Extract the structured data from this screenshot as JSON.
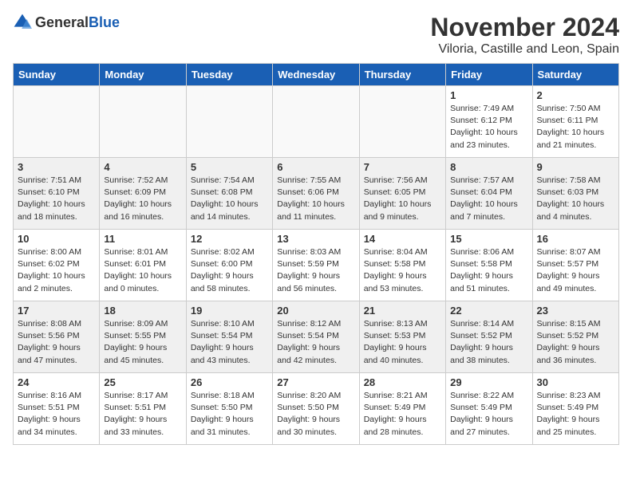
{
  "header": {
    "logo_general": "General",
    "logo_blue": "Blue",
    "month_title": "November 2024",
    "location": "Viloria, Castille and Leon, Spain"
  },
  "weekdays": [
    "Sunday",
    "Monday",
    "Tuesday",
    "Wednesday",
    "Thursday",
    "Friday",
    "Saturday"
  ],
  "weeks": [
    [
      {
        "day": "",
        "info": ""
      },
      {
        "day": "",
        "info": ""
      },
      {
        "day": "",
        "info": ""
      },
      {
        "day": "",
        "info": ""
      },
      {
        "day": "",
        "info": ""
      },
      {
        "day": "1",
        "info": "Sunrise: 7:49 AM\nSunset: 6:12 PM\nDaylight: 10 hours\nand 23 minutes."
      },
      {
        "day": "2",
        "info": "Sunrise: 7:50 AM\nSunset: 6:11 PM\nDaylight: 10 hours\nand 21 minutes."
      }
    ],
    [
      {
        "day": "3",
        "info": "Sunrise: 7:51 AM\nSunset: 6:10 PM\nDaylight: 10 hours\nand 18 minutes."
      },
      {
        "day": "4",
        "info": "Sunrise: 7:52 AM\nSunset: 6:09 PM\nDaylight: 10 hours\nand 16 minutes."
      },
      {
        "day": "5",
        "info": "Sunrise: 7:54 AM\nSunset: 6:08 PM\nDaylight: 10 hours\nand 14 minutes."
      },
      {
        "day": "6",
        "info": "Sunrise: 7:55 AM\nSunset: 6:06 PM\nDaylight: 10 hours\nand 11 minutes."
      },
      {
        "day": "7",
        "info": "Sunrise: 7:56 AM\nSunset: 6:05 PM\nDaylight: 10 hours\nand 9 minutes."
      },
      {
        "day": "8",
        "info": "Sunrise: 7:57 AM\nSunset: 6:04 PM\nDaylight: 10 hours\nand 7 minutes."
      },
      {
        "day": "9",
        "info": "Sunrise: 7:58 AM\nSunset: 6:03 PM\nDaylight: 10 hours\nand 4 minutes."
      }
    ],
    [
      {
        "day": "10",
        "info": "Sunrise: 8:00 AM\nSunset: 6:02 PM\nDaylight: 10 hours\nand 2 minutes."
      },
      {
        "day": "11",
        "info": "Sunrise: 8:01 AM\nSunset: 6:01 PM\nDaylight: 10 hours\nand 0 minutes."
      },
      {
        "day": "12",
        "info": "Sunrise: 8:02 AM\nSunset: 6:00 PM\nDaylight: 9 hours\nand 58 minutes."
      },
      {
        "day": "13",
        "info": "Sunrise: 8:03 AM\nSunset: 5:59 PM\nDaylight: 9 hours\nand 56 minutes."
      },
      {
        "day": "14",
        "info": "Sunrise: 8:04 AM\nSunset: 5:58 PM\nDaylight: 9 hours\nand 53 minutes."
      },
      {
        "day": "15",
        "info": "Sunrise: 8:06 AM\nSunset: 5:58 PM\nDaylight: 9 hours\nand 51 minutes."
      },
      {
        "day": "16",
        "info": "Sunrise: 8:07 AM\nSunset: 5:57 PM\nDaylight: 9 hours\nand 49 minutes."
      }
    ],
    [
      {
        "day": "17",
        "info": "Sunrise: 8:08 AM\nSunset: 5:56 PM\nDaylight: 9 hours\nand 47 minutes."
      },
      {
        "day": "18",
        "info": "Sunrise: 8:09 AM\nSunset: 5:55 PM\nDaylight: 9 hours\nand 45 minutes."
      },
      {
        "day": "19",
        "info": "Sunrise: 8:10 AM\nSunset: 5:54 PM\nDaylight: 9 hours\nand 43 minutes."
      },
      {
        "day": "20",
        "info": "Sunrise: 8:12 AM\nSunset: 5:54 PM\nDaylight: 9 hours\nand 42 minutes."
      },
      {
        "day": "21",
        "info": "Sunrise: 8:13 AM\nSunset: 5:53 PM\nDaylight: 9 hours\nand 40 minutes."
      },
      {
        "day": "22",
        "info": "Sunrise: 8:14 AM\nSunset: 5:52 PM\nDaylight: 9 hours\nand 38 minutes."
      },
      {
        "day": "23",
        "info": "Sunrise: 8:15 AM\nSunset: 5:52 PM\nDaylight: 9 hours\nand 36 minutes."
      }
    ],
    [
      {
        "day": "24",
        "info": "Sunrise: 8:16 AM\nSunset: 5:51 PM\nDaylight: 9 hours\nand 34 minutes."
      },
      {
        "day": "25",
        "info": "Sunrise: 8:17 AM\nSunset: 5:51 PM\nDaylight: 9 hours\nand 33 minutes."
      },
      {
        "day": "26",
        "info": "Sunrise: 8:18 AM\nSunset: 5:50 PM\nDaylight: 9 hours\nand 31 minutes."
      },
      {
        "day": "27",
        "info": "Sunrise: 8:20 AM\nSunset: 5:50 PM\nDaylight: 9 hours\nand 30 minutes."
      },
      {
        "day": "28",
        "info": "Sunrise: 8:21 AM\nSunset: 5:49 PM\nDaylight: 9 hours\nand 28 minutes."
      },
      {
        "day": "29",
        "info": "Sunrise: 8:22 AM\nSunset: 5:49 PM\nDaylight: 9 hours\nand 27 minutes."
      },
      {
        "day": "30",
        "info": "Sunrise: 8:23 AM\nSunset: 5:49 PM\nDaylight: 9 hours\nand 25 minutes."
      }
    ]
  ]
}
